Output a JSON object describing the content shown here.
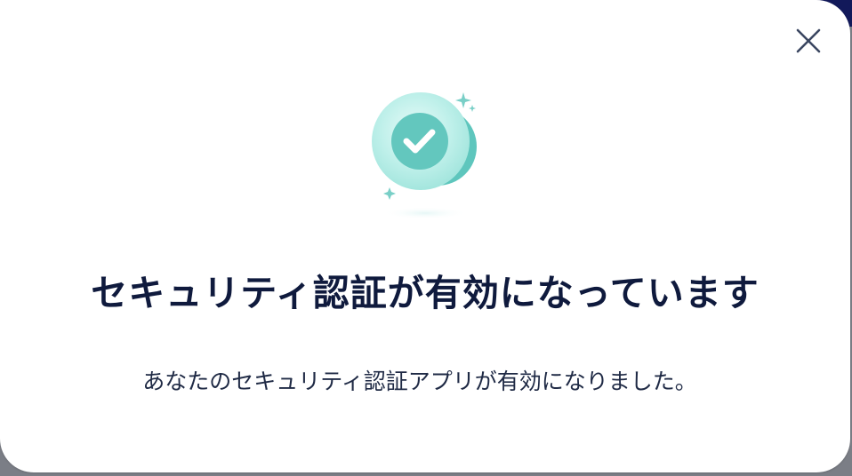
{
  "dialog": {
    "title": "セキュリティ認証が有効になっています",
    "message": "あなたのセキュリティ認証アプリが有効になりました。",
    "close_icon": "close-icon",
    "illustration_icon": "check-circle-icon"
  },
  "colors": {
    "accent_teal": "#5cc6be",
    "title_text": "#0f1a3d",
    "body_text": "#1f2a45",
    "backdrop_navy": "#12195a"
  }
}
